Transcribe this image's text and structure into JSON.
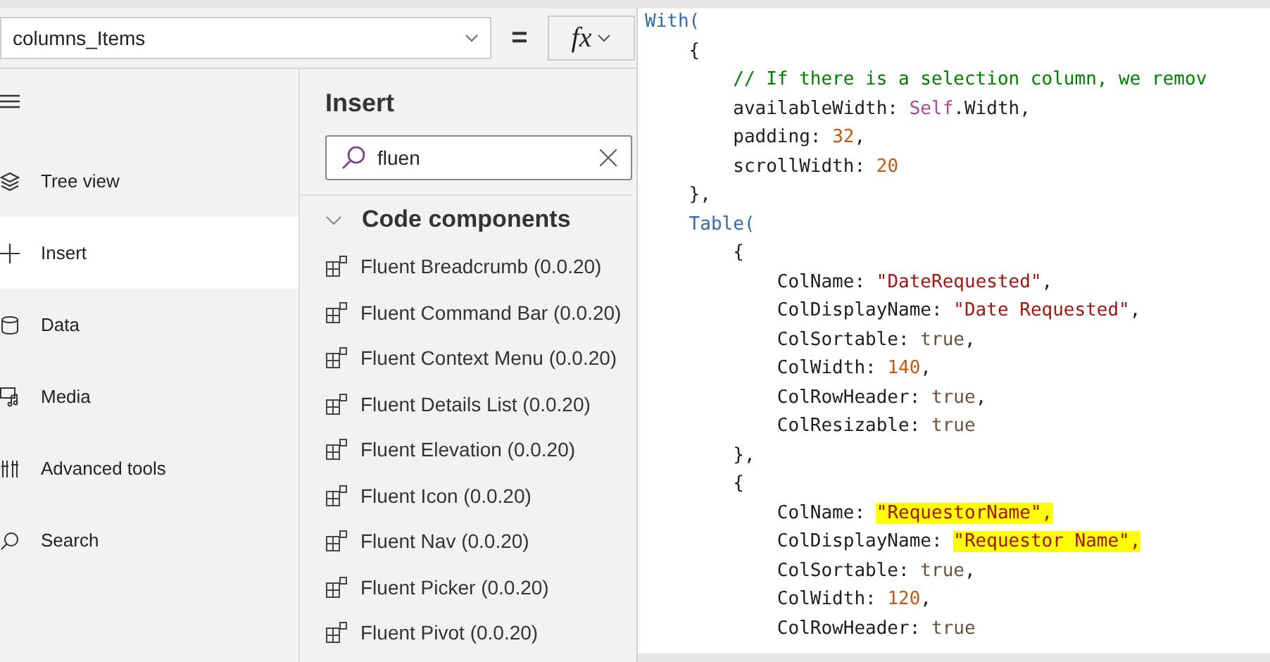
{
  "formula_bar": {
    "property": "columns_Items",
    "equals": "=",
    "fx": "fx"
  },
  "nav": {
    "items": [
      {
        "label": "Tree view",
        "selected": false
      },
      {
        "label": "Insert",
        "selected": true
      },
      {
        "label": "Data",
        "selected": false
      },
      {
        "label": "Media",
        "selected": false
      },
      {
        "label": "Advanced tools",
        "selected": false
      },
      {
        "label": "Search",
        "selected": false
      }
    ]
  },
  "insert_panel": {
    "title": "Insert",
    "search": {
      "value": "fluen"
    },
    "section": {
      "title": "Code components",
      "expanded": true,
      "items": [
        "Fluent Breadcrumb (0.0.20)",
        "Fluent Command Bar (0.0.20)",
        "Fluent Context Menu (0.0.20)",
        "Fluent Details List (0.0.20)",
        "Fluent Elevation (0.0.20)",
        "Fluent Icon (0.0.20)",
        "Fluent Nav (0.0.20)",
        "Fluent Picker (0.0.20)",
        "Fluent Pivot (0.0.20)"
      ]
    }
  },
  "code_lines": [
    [
      {
        "t": "With(",
        "kind": "keyword",
        "highlighted": false
      }
    ],
    [
      {
        "t": "    {",
        "kind": "plain",
        "highlighted": false
      }
    ],
    [
      {
        "t": "        // If there is a selection column, we remov",
        "kind": "comment",
        "highlighted": false
      }
    ],
    [
      {
        "t": "        availableWidth: ",
        "kind": "plain",
        "highlighted": false
      },
      {
        "t": "Self",
        "kind": "self",
        "highlighted": false
      },
      {
        "t": ".Width,",
        "kind": "plain",
        "highlighted": false
      }
    ],
    [
      {
        "t": "        padding: ",
        "kind": "plain",
        "highlighted": false
      },
      {
        "t": "32",
        "kind": "number",
        "highlighted": false
      },
      {
        "t": ",",
        "kind": "plain",
        "highlighted": false
      }
    ],
    [
      {
        "t": "        scrollWidth: ",
        "kind": "plain",
        "highlighted": false
      },
      {
        "t": "20",
        "kind": "number",
        "highlighted": false
      }
    ],
    [
      {
        "t": "    },",
        "kind": "plain",
        "highlighted": false
      }
    ],
    [
      {
        "t": "    Table(",
        "kind": "keyword",
        "highlighted": false
      }
    ],
    [
      {
        "t": "        {",
        "kind": "plain",
        "highlighted": false
      }
    ],
    [
      {
        "t": "            ColName: ",
        "kind": "plain",
        "highlighted": false
      },
      {
        "t": "\"DateRequested\"",
        "kind": "string",
        "highlighted": false
      },
      {
        "t": ",",
        "kind": "plain",
        "highlighted": false
      }
    ],
    [
      {
        "t": "            ColDisplayName: ",
        "kind": "plain",
        "highlighted": false
      },
      {
        "t": "\"Date Requested\"",
        "kind": "string",
        "highlighted": false
      },
      {
        "t": ",",
        "kind": "plain",
        "highlighted": false
      }
    ],
    [
      {
        "t": "            ColSortable: ",
        "kind": "plain",
        "highlighted": false
      },
      {
        "t": "true",
        "kind": "bool",
        "highlighted": false
      },
      {
        "t": ",",
        "kind": "plain",
        "highlighted": false
      }
    ],
    [
      {
        "t": "            ColWidth: ",
        "kind": "plain",
        "highlighted": false
      },
      {
        "t": "140",
        "kind": "number",
        "highlighted": false
      },
      {
        "t": ",",
        "kind": "plain",
        "highlighted": false
      }
    ],
    [
      {
        "t": "            ColRowHeader: ",
        "kind": "plain",
        "highlighted": false
      },
      {
        "t": "true",
        "kind": "bool",
        "highlighted": false
      },
      {
        "t": ",",
        "kind": "plain",
        "highlighted": false
      }
    ],
    [
      {
        "t": "            ColResizable: ",
        "kind": "plain",
        "highlighted": false
      },
      {
        "t": "true",
        "kind": "bool",
        "highlighted": false
      }
    ],
    [
      {
        "t": "        },",
        "kind": "plain",
        "highlighted": false
      }
    ],
    [
      {
        "t": "        {",
        "kind": "plain",
        "highlighted": false
      }
    ],
    [
      {
        "t": "            ColName: ",
        "kind": "plain",
        "highlighted": false
      },
      {
        "t": "\"RequestorName\",",
        "kind": "string",
        "highlighted": true
      }
    ],
    [
      {
        "t": "            ColDisplayName: ",
        "kind": "plain",
        "highlighted": false
      },
      {
        "t": "\"Requestor Name\",",
        "kind": "string",
        "highlighted": true
      }
    ],
    [
      {
        "t": "            ColSortable: ",
        "kind": "plain",
        "highlighted": false
      },
      {
        "t": "true",
        "kind": "bool",
        "highlighted": false
      },
      {
        "t": ",",
        "kind": "plain",
        "highlighted": false
      }
    ],
    [
      {
        "t": "            ColWidth: ",
        "kind": "plain",
        "highlighted": false
      },
      {
        "t": "120",
        "kind": "number",
        "highlighted": false
      },
      {
        "t": ",",
        "kind": "plain",
        "highlighted": false
      }
    ],
    [
      {
        "t": "            ColRowHeader: ",
        "kind": "plain",
        "highlighted": false
      },
      {
        "t": "true",
        "kind": "bool",
        "highlighted": false
      }
    ]
  ]
}
